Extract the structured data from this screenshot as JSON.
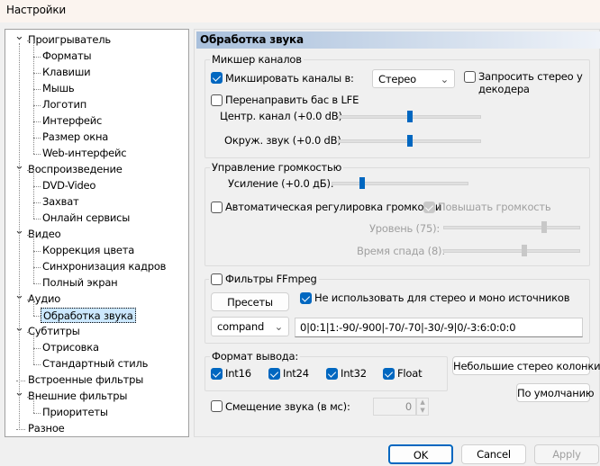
{
  "window": {
    "title": "Настройки"
  },
  "tree": [
    {
      "label": "Проигрыватель",
      "level": 0,
      "expanded": true
    },
    {
      "label": "Форматы",
      "level": 1
    },
    {
      "label": "Клавиши",
      "level": 1
    },
    {
      "label": "Мышь",
      "level": 1
    },
    {
      "label": "Логотип",
      "level": 1
    },
    {
      "label": "Интерфейс",
      "level": 1
    },
    {
      "label": "Размер окна",
      "level": 1
    },
    {
      "label": "Web-интерфейс",
      "level": 1
    },
    {
      "label": "Воспроизведение",
      "level": 0,
      "expanded": true
    },
    {
      "label": "DVD-Video",
      "level": 1
    },
    {
      "label": "Захват",
      "level": 1
    },
    {
      "label": "Онлайн сервисы",
      "level": 1
    },
    {
      "label": "Видео",
      "level": 0,
      "expanded": true
    },
    {
      "label": "Коррекция цвета",
      "level": 1
    },
    {
      "label": "Синхронизация кадров",
      "level": 1
    },
    {
      "label": "Полный экран",
      "level": 1
    },
    {
      "label": "Аудио",
      "level": 0,
      "expanded": true
    },
    {
      "label": "Обработка звука",
      "level": 1,
      "selected": true
    },
    {
      "label": "Субтитры",
      "level": 0,
      "expanded": true
    },
    {
      "label": "Отрисовка",
      "level": 1
    },
    {
      "label": "Стандартный стиль",
      "level": 1
    },
    {
      "label": "Встроенные фильтры",
      "level": 0
    },
    {
      "label": "Внешние фильтры",
      "level": 0,
      "expanded": true
    },
    {
      "label": "Приоритеты",
      "level": 1
    },
    {
      "label": "Разное",
      "level": 0
    }
  ],
  "page": {
    "title": "Обработка звука"
  },
  "mixer": {
    "group": "Микшер каналов",
    "mix_label": "Микшировать каналы в:",
    "mix_checked": true,
    "mix_value": "Стерео",
    "request_stereo": "Запросить стерео у",
    "request_stereo2": "декодера",
    "request_checked": false,
    "lfe_label": "Перенаправить бас в LFE",
    "lfe_checked": false,
    "center_label": "Центр. канал (+0.0 dB)",
    "center_value": 0.5,
    "surround_label": "Окруж. звук (+0.0 dB)",
    "surround_value": 0.5
  },
  "volume": {
    "group": "Управление громкостью",
    "gain_label": "Усиление (+0.0 дБ):",
    "gain_value": 0.22,
    "auto_label": "Автоматическая регулировка громкости",
    "auto_checked": false,
    "boost_label": "Повышать громкость",
    "boost_checked": true,
    "level_label": "Уровень (75):",
    "level_value": 0.74,
    "release_label": "Время спада (8):",
    "release_value": 0.59
  },
  "ffmpeg": {
    "label": "Фильтры FFmpeg",
    "checked": false,
    "presets": "Пресеты",
    "skip_label": "Не использовать для стерео и моно источников",
    "skip_checked": true,
    "filter": "compand",
    "args": "0|0:1|1:-90/-900|-70/-70|-30/-9|0/-3:6:0:0:0"
  },
  "output": {
    "group": "Формат вывода:",
    "formats": [
      {
        "label": "Int16",
        "checked": true
      },
      {
        "label": "Int24",
        "checked": true
      },
      {
        "label": "Int32",
        "checked": true
      },
      {
        "label": "Float",
        "checked": true
      }
    ]
  },
  "buttons": {
    "small_speakers": "Небольшие стерео колонки",
    "defaults": "По умолчанию",
    "ok": "OK",
    "cancel": "Cancel",
    "apply": "Apply"
  },
  "delay": {
    "label": "Смещение звука (в мс):",
    "checked": false,
    "value": "0"
  },
  "colors": {
    "accent": "#0067c0",
    "header": "#a9c0dc"
  }
}
